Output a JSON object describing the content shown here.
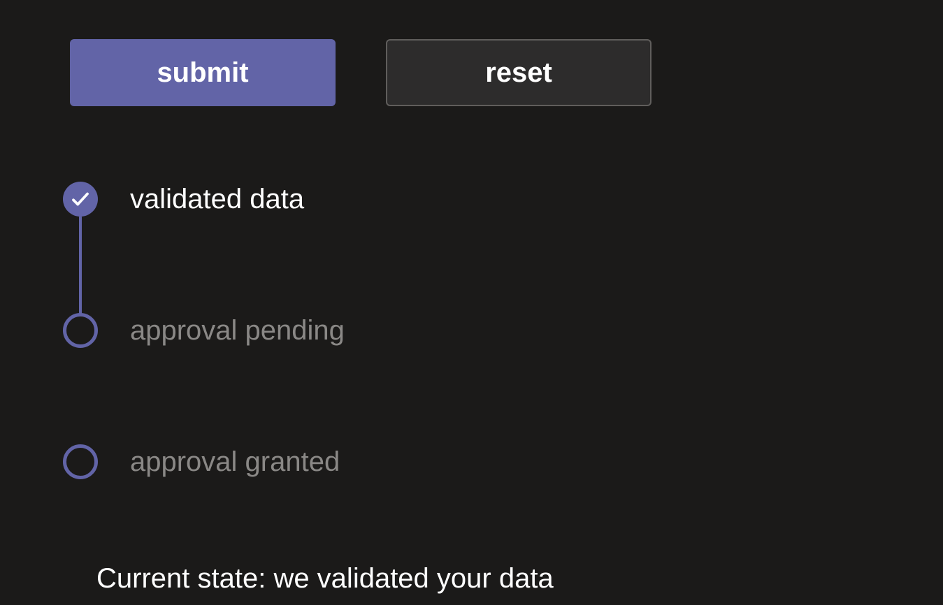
{
  "buttons": {
    "submit": "submit",
    "reset": "reset"
  },
  "steps": [
    {
      "label": "validated data",
      "state": "completed"
    },
    {
      "label": "approval pending",
      "state": "pending"
    },
    {
      "label": "approval granted",
      "state": "pending"
    }
  ],
  "status": {
    "text": "Current state: we validated your data"
  },
  "colors": {
    "accent": "#6264a7",
    "background": "#1b1a19",
    "textPrimary": "#ffffff",
    "textSecondary": "#8a8886"
  }
}
